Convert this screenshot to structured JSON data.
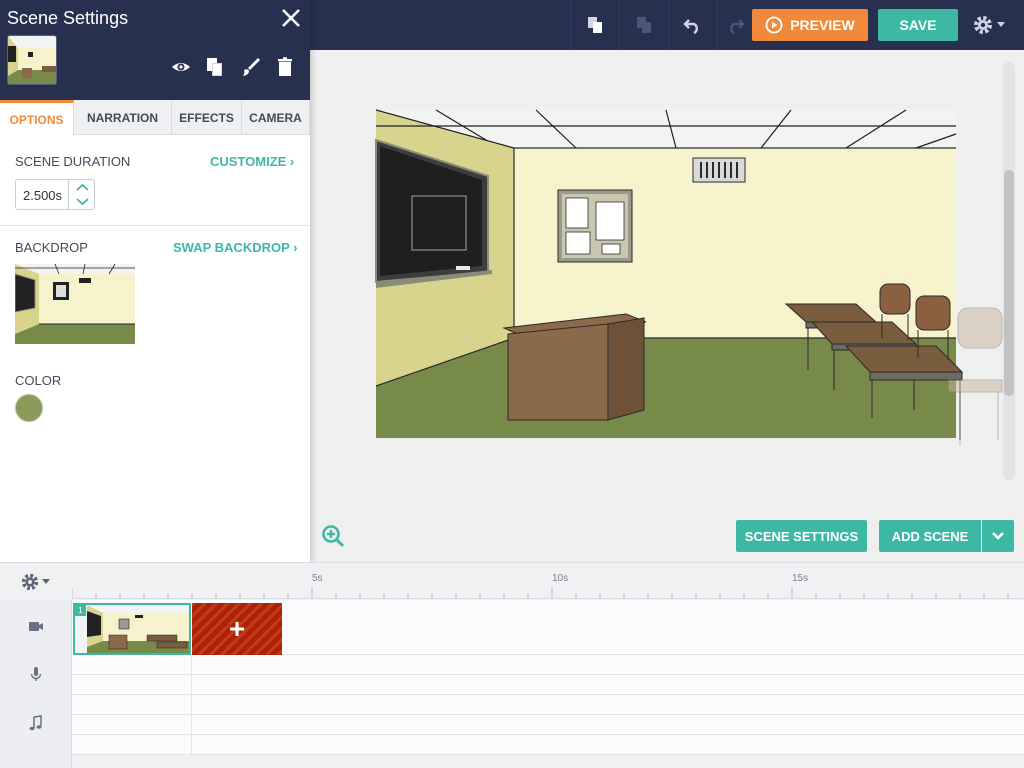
{
  "topbar": {
    "preview_label": "PREVIEW",
    "save_label": "SAVE",
    "accent_color": "#f08a3a",
    "save_color": "#3cb8a3",
    "background": "#27314f"
  },
  "panel": {
    "title": "Scene Settings",
    "tabs": [
      {
        "label": "OPTIONS",
        "active": true
      },
      {
        "label": "NARRATION",
        "active": false
      },
      {
        "label": "EFFECTS",
        "active": false
      },
      {
        "label": "CAMERA",
        "active": false
      }
    ],
    "scene_duration_label": "SCENE DURATION",
    "customize_link": "CUSTOMIZE ›",
    "duration_value": "2.500s",
    "backdrop_label": "BACKDROP",
    "swap_backdrop_link": "SWAP BACKDROP ›",
    "color_label": "COLOR",
    "color_value": "#8a9a58"
  },
  "stage": {
    "scene_settings_label": "SCENE SETTINGS",
    "add_scene_label": "ADD SCENE"
  },
  "timeline": {
    "marks": [
      "5s",
      "10s",
      "15s"
    ],
    "scene_number": "1",
    "add_icon": "+",
    "tracks": [
      "camera-icon",
      "microphone-icon",
      "music-note-icon"
    ]
  }
}
